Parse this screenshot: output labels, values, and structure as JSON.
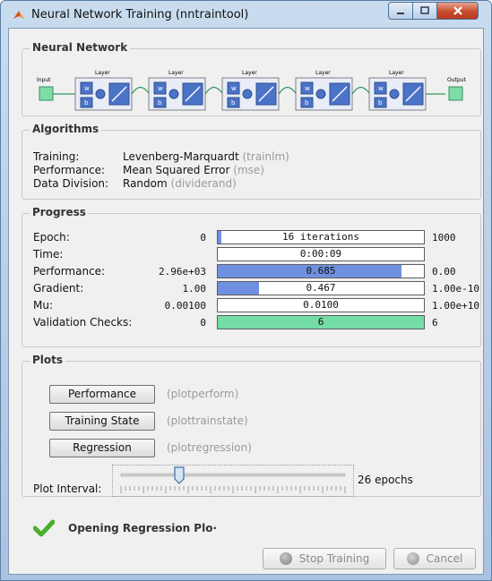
{
  "window": {
    "title": "Neural Network Training (nntraintool)"
  },
  "neural_network": {
    "section_title": "Neural Network",
    "input_label": "Input",
    "output_label": "Output",
    "layer_label": "Layer",
    "w_label": "w",
    "b_label": "b",
    "layers": [
      "Layer",
      "Layer",
      "Layer",
      "Layer",
      "Layer"
    ]
  },
  "algorithms": {
    "section_title": "Algorithms",
    "rows": [
      {
        "label": "Training:",
        "value": "Levenberg-Marquardt",
        "fn": "(trainlm)"
      },
      {
        "label": "Performance:",
        "value": "Mean Squared Error",
        "fn": "(mse)"
      },
      {
        "label": "Data Division:",
        "value": "Random",
        "fn": "(dividerand)"
      }
    ]
  },
  "progress": {
    "section_title": "Progress",
    "rows": [
      {
        "label": "Epoch:",
        "left": "0",
        "bar_text": "16 iterations",
        "right": "1000",
        "fill_fraction": 0.016,
        "fill_color": "#6f8fe0"
      },
      {
        "label": "Time:",
        "left": "",
        "bar_text": "0:00:09",
        "right": "",
        "fill_fraction": 0,
        "fill_color": "#6f8fe0"
      },
      {
        "label": "Performance:",
        "left": "2.96e+03",
        "bar_text": "0.685",
        "right": "0.00",
        "fill_fraction": 0.89,
        "fill_color": "#6f8fe0"
      },
      {
        "label": "Gradient:",
        "left": "1.00",
        "bar_text": "0.467",
        "right": "1.00e-10",
        "fill_fraction": 0.2,
        "fill_color": "#6f8fe0"
      },
      {
        "label": "Mu:",
        "left": "0.00100",
        "bar_text": "0.0100",
        "right": "1.00e+10",
        "fill_fraction": 0.0,
        "fill_color": "#6f8fe0"
      },
      {
        "label": "Validation Checks:",
        "left": "0",
        "bar_text": "6",
        "right": "6",
        "fill_fraction": 1.0,
        "fill_color": "#74dca7"
      }
    ]
  },
  "plots": {
    "section_title": "Plots",
    "buttons": [
      {
        "label": "Performance",
        "fn": "(plotperform)"
      },
      {
        "label": "Training State",
        "fn": "(plottrainstate)"
      },
      {
        "label": "Regression",
        "fn": "(plotregression)"
      }
    ],
    "interval_label": "Plot Interval:",
    "interval_value_text": "26 epochs",
    "slider_fraction": 0.26
  },
  "status": {
    "text": "Opening Regression Plo·"
  },
  "footer": {
    "stop_label": "Stop Training",
    "cancel_label": "Cancel"
  },
  "colors": {
    "accent": "#6f8fe0",
    "validation": "#74dca7",
    "check": "#4cae2b"
  }
}
